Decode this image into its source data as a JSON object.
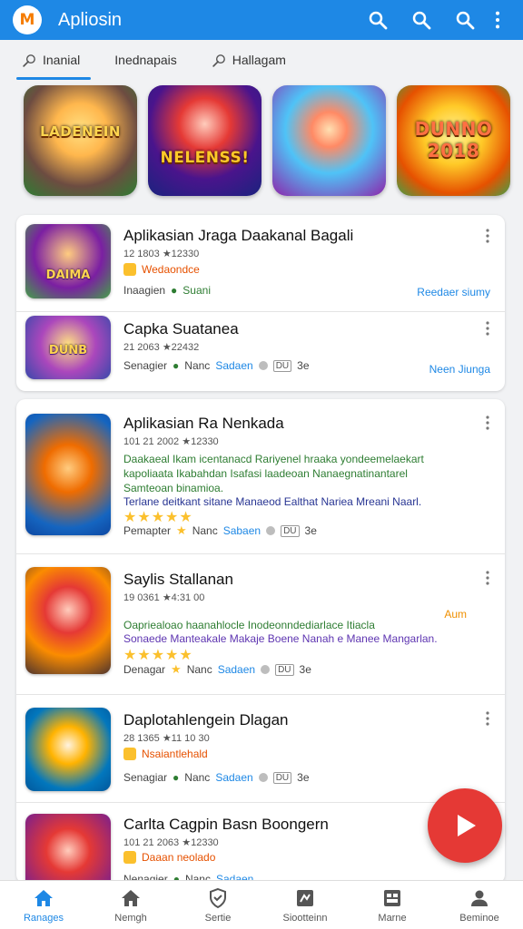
{
  "app": {
    "title": "Apliosin",
    "logo_text": "M"
  },
  "tabs": [
    {
      "label": "Inanial",
      "active": true
    },
    {
      "label": "Inednapais",
      "active": false
    },
    {
      "label": "Hallagam",
      "active": false
    }
  ],
  "banners": [
    {
      "caption": "LADENEIN",
      "colors": [
        "#ffb74d",
        "#2e7d32"
      ]
    },
    {
      "caption": "NELENSS!",
      "colors": [
        "#1a237e",
        "#e53935"
      ]
    },
    {
      "caption": "",
      "colors": [
        "#4fc3f7",
        "#8e24aa"
      ]
    },
    {
      "caption": "DUNNO 2018",
      "colors": [
        "#ffca28",
        "#43a047"
      ]
    }
  ],
  "card1": {
    "items": [
      {
        "title": "Aplikasian Jraga Daakanal Bagali",
        "meta": "12 1803 ★12330",
        "badge": "Wedaondce",
        "foot_left": "Inaagien",
        "foot_mid": "Suani",
        "link": "Reedaer siumy",
        "thumb_label": "DAIMA",
        "thumb_colors": [
          "#7b1fa2",
          "#43a047"
        ]
      },
      {
        "title": "Capka Suatanea",
        "meta": "21 2063 ★22432",
        "foot_left": "Senagier",
        "foot_mid": "Nanc",
        "foot_blue": "Sadaen",
        "foot_box": "DU",
        "foot_end": "3e",
        "link": "Neen Jiunga",
        "thumb_label": "DUNB",
        "thumb_colors": [
          "#3949ab",
          "#ab47bc"
        ]
      }
    ]
  },
  "card2": {
    "items": [
      {
        "title": "Aplikasian Ra Nenkada",
        "meta": "101 21 2002 ★12330",
        "desc_lines": [
          "Daakaeal Ikam icentanacd Rariyenel hraaka yondeemelaekart",
          "kapoliaata Ikabahdan Isafasi laadeoan Nanaegnatinantarel",
          "Samteoan binamioa."
        ],
        "desc_line4": "Terlane deitkant sitane Manaeod Ealthat Nariea Mreani Naarl.",
        "stars": "★★★★★",
        "foot_left": "Pemapter",
        "foot_mid": "Nanc",
        "foot_blue": "Sabaen",
        "foot_box": "DU",
        "foot_end": "3e",
        "thumb_colors": [
          "#1565c0",
          "#ef6c00"
        ]
      },
      {
        "title": "Saylis Stallanan",
        "meta": "19 0361 ★4:31 00",
        "link": "Aum",
        "desc_lines": [
          "Oapriealoao haanahlocle Inodeonndediarlace Itiacla",
          "Sonaede Manteakale Makaje Boene Nanah e Manee Mangarlan."
        ],
        "stars": "★★★★★",
        "foot_left": "Denagar",
        "foot_mid": "Nanc",
        "foot_blue": "Sadaen",
        "foot_box": "DU",
        "foot_end": "3e",
        "thumb_colors": [
          "#fb8c00",
          "#4e342e"
        ]
      },
      {
        "title": "Daplotahlengein Dlagan",
        "meta": "28 1365 ★11 10 30",
        "badge": "Nsaiantlehald",
        "foot_left": "Senagiar",
        "foot_mid": "Nanc",
        "foot_blue": "Sadaen",
        "foot_box": "DU",
        "foot_end": "3e",
        "thumb_colors": [
          "#0277bd",
          "#ffb300"
        ]
      },
      {
        "title": "Carlta Cagpin Basn Boongern",
        "meta": "101 21 2063 ★12330",
        "badge": "Daaan neolado",
        "foot_left": "Nenagier",
        "foot_mid": "Nanc",
        "foot_blue": "Sadaen",
        "thumb_colors": [
          "#6a1b9a",
          "#e53935"
        ]
      }
    ]
  },
  "nav": [
    {
      "label": "Ranages",
      "icon": "home-icon",
      "active": true
    },
    {
      "label": "Nemgh",
      "icon": "home-outline-icon",
      "active": false
    },
    {
      "label": "Sertie",
      "icon": "shield-icon",
      "active": false
    },
    {
      "label": "Siootteinn",
      "icon": "gamepad-icon",
      "active": false
    },
    {
      "label": "Marne",
      "icon": "controller-icon",
      "active": false
    },
    {
      "label": "Beminoe",
      "icon": "profile-icon",
      "active": false
    }
  ],
  "colors": {
    "primary": "#1e88e5",
    "fab": "#e53935",
    "star": "#fbc02d",
    "desc_green": "#2e7d32"
  }
}
